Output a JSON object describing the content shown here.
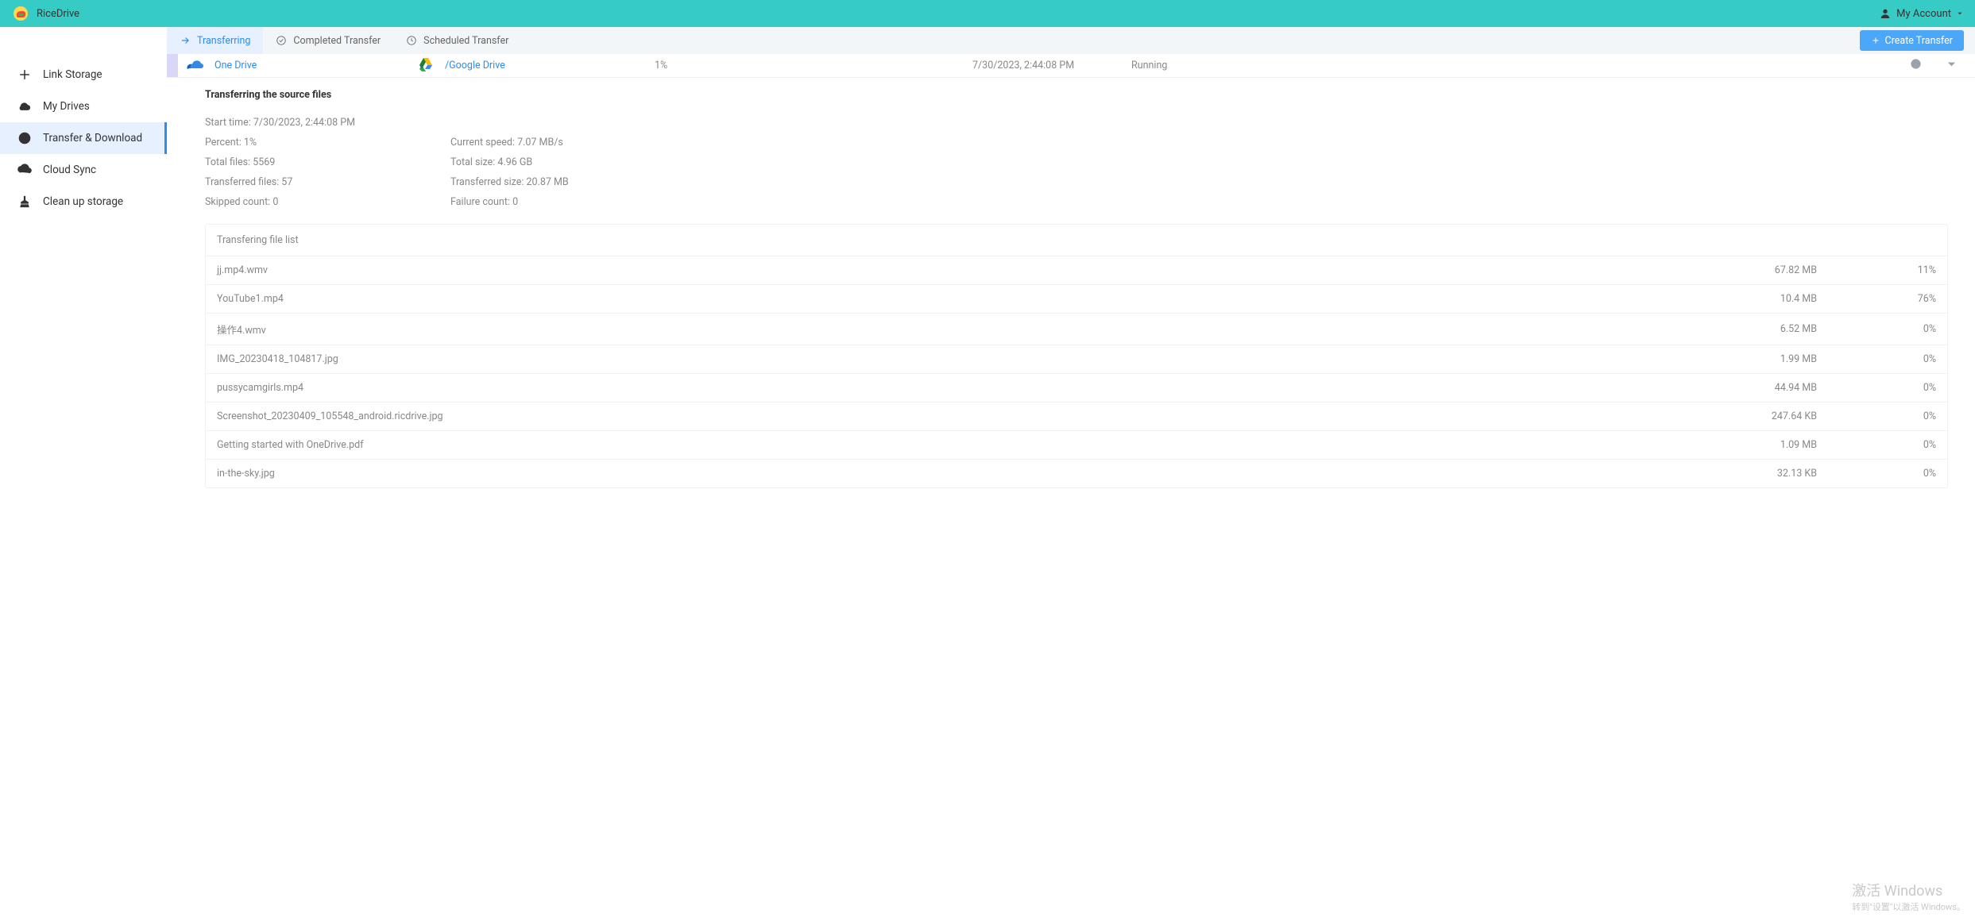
{
  "brand": {
    "name": "RiceDrive"
  },
  "account": {
    "label": "My Account"
  },
  "sidebar": {
    "items": [
      {
        "label": "Link Storage"
      },
      {
        "label": "My Drives"
      },
      {
        "label": "Transfer & Download"
      },
      {
        "label": "Cloud Sync"
      },
      {
        "label": "Clean up storage"
      }
    ],
    "active_index": 2
  },
  "tabs": {
    "items": [
      {
        "label": "Transferring"
      },
      {
        "label": "Completed Transfer"
      },
      {
        "label": "Scheduled Transfer"
      }
    ],
    "active_index": 0,
    "create_label": "Create Transfer"
  },
  "transfer": {
    "source": "One Drive",
    "destination": "/Google Drive",
    "percent": "1%",
    "timestamp": "7/30/2023, 2:44:08 PM",
    "status": "Running"
  },
  "details": {
    "title": "Transferring the source files",
    "left": {
      "start_time_label": "Start time:",
      "start_time": "7/30/2023, 2:44:08 PM",
      "percent_label": "Percent:",
      "percent": "1%",
      "total_files_label": "Total files:",
      "total_files": "5569",
      "transferred_files_label": "Transferred files:",
      "transferred_files": "57",
      "skipped_label": "Skipped count:",
      "skipped": "0"
    },
    "right": {
      "speed_label": "Current speed:",
      "speed": "7.07 MB/s",
      "total_size_label": "Total size:",
      "total_size": "4.96 GB",
      "transferred_size_label": "Transferred size:",
      "transferred_size": "20.87 MB",
      "failure_label": "Failure count:",
      "failure": "0"
    }
  },
  "file_list": {
    "head": "Transfering file list",
    "rows": [
      {
        "name": "jj.mp4.wmv",
        "size": "67.82 MB",
        "pct": "11%"
      },
      {
        "name": "YouTube1.mp4",
        "size": "10.4 MB",
        "pct": "76%"
      },
      {
        "name": "操作4.wmv",
        "size": "6.52 MB",
        "pct": "0%"
      },
      {
        "name": "IMG_20230418_104817.jpg",
        "size": "1.99 MB",
        "pct": "0%"
      },
      {
        "name": "pussycamgirls.mp4",
        "size": "44.94 MB",
        "pct": "0%"
      },
      {
        "name": "Screenshot_20230409_105548_android.ricdrive.jpg",
        "size": "247.64 KB",
        "pct": "0%"
      },
      {
        "name": "Getting started with OneDrive.pdf",
        "size": "1.09 MB",
        "pct": "0%"
      },
      {
        "name": "in-the-sky.jpg",
        "size": "32.13 KB",
        "pct": "0%"
      }
    ]
  },
  "watermark": {
    "line1": "激活 Windows",
    "line2": "转到\"设置\"以激活 Windows。"
  }
}
